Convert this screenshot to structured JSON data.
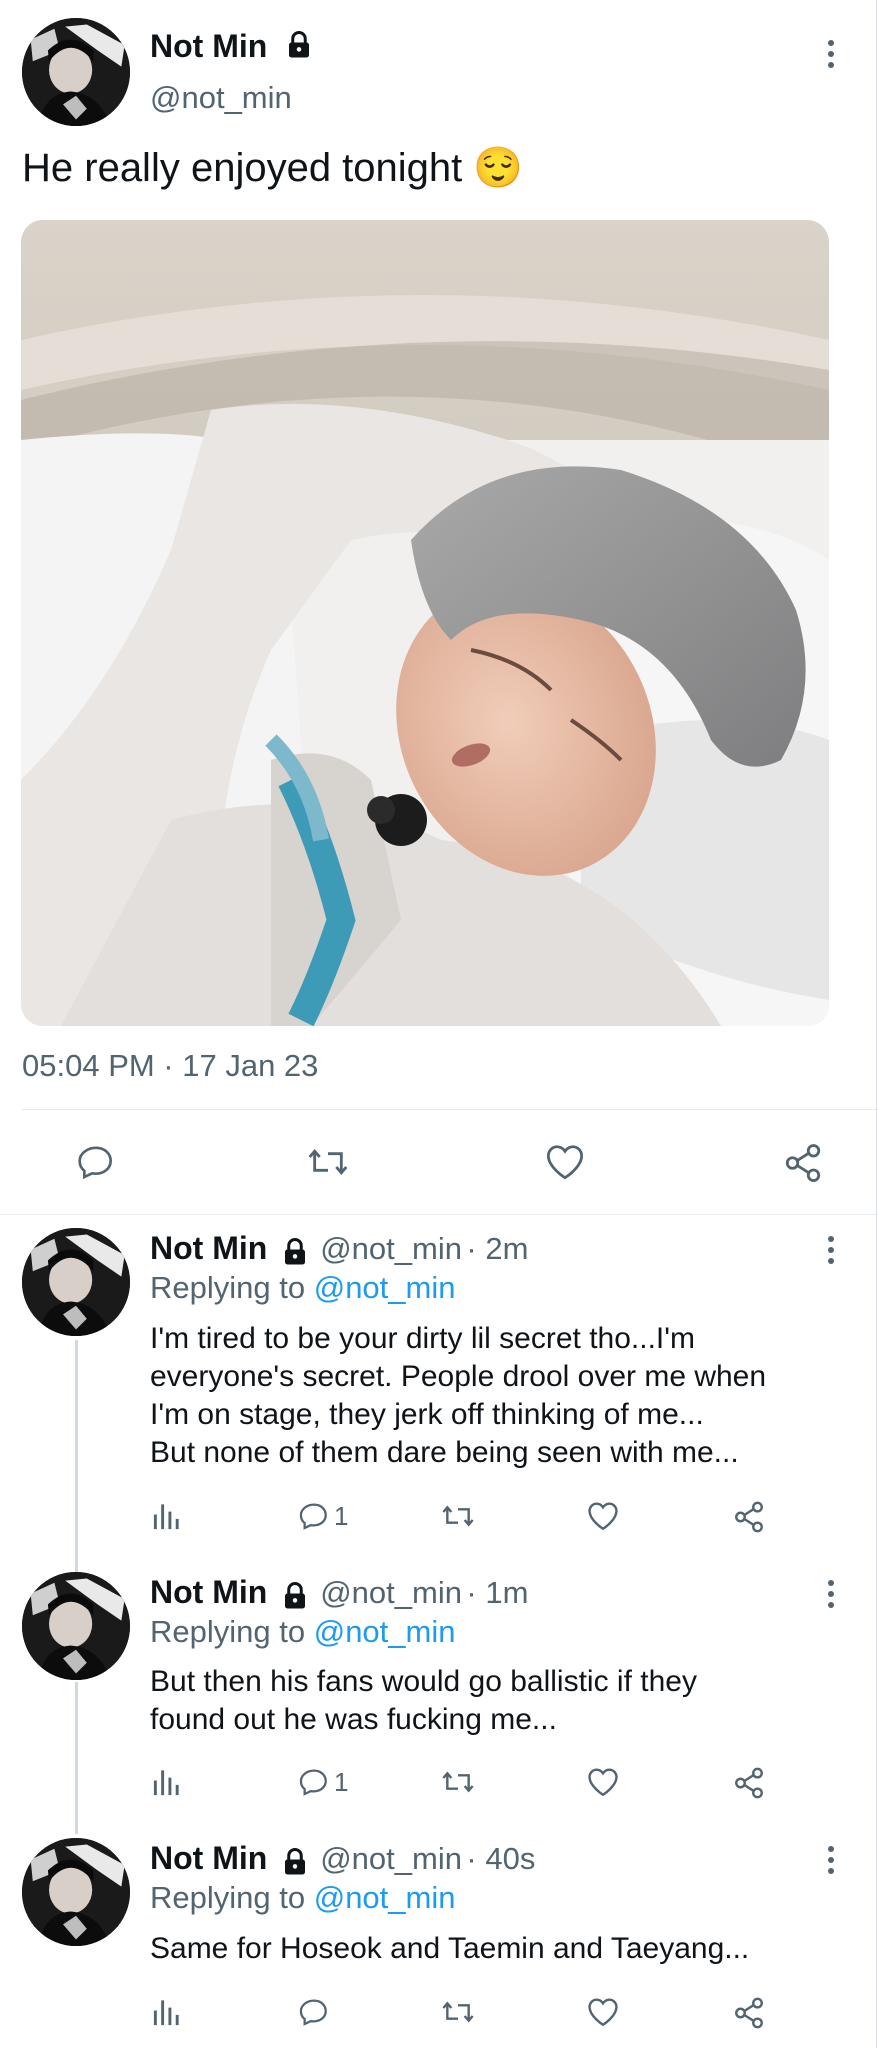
{
  "main_tweet": {
    "author_name": "Not Min",
    "author_handle": "@not_min",
    "text": "He really enjoyed tonight 😌",
    "timestamp": "05:04 PM · 17 Jan 23",
    "actions": [
      "reply-icon",
      "retweet-icon",
      "like-icon",
      "share-icon"
    ]
  },
  "replies": [
    {
      "author_name": "Not Min",
      "author_handle": "@not_min",
      "time": "· 2m",
      "replying_prefix": "Replying to",
      "replying_to": "@not_min",
      "lines": [
        "I'm tired to be your dirty lil secret tho...I'm",
        "everyone's secret. People drool over me when",
        "I'm on stage, they jerk off thinking of me...",
        "But none of them dare being seen with me..."
      ],
      "reply_count": "1"
    },
    {
      "author_name": "Not Min",
      "author_handle": "@not_min",
      "time": "· 1m",
      "replying_prefix": "Replying to",
      "replying_to": "@not_min",
      "lines": [
        "But then his fans would go ballistic if they",
        "found out he was fucking me..."
      ],
      "reply_count": "1"
    },
    {
      "author_name": "Not Min",
      "author_handle": "@not_min",
      "time": "· 40s",
      "replying_prefix": "Replying to",
      "replying_to": "@not_min",
      "lines": [
        "Same for Hoseok and Taemin and Taeyang..."
      ],
      "reply_count": ""
    }
  ],
  "colors": {
    "accent": "#1d9bf0",
    "secondary_text": "#536471",
    "divider": "#e6ecf0"
  }
}
